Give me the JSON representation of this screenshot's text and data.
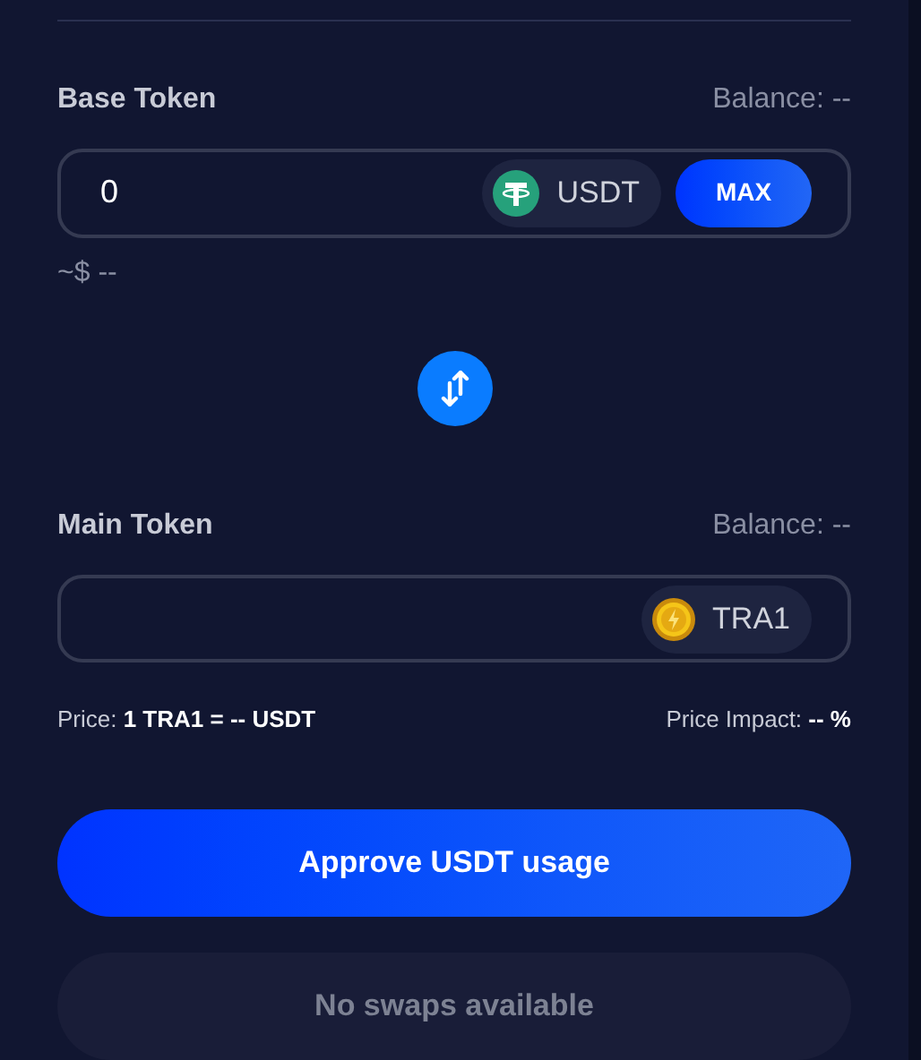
{
  "sections": [
    {
      "label": "Base Token",
      "balance": "Balance: --",
      "amount": "0",
      "token": "USDT",
      "max_button": "MAX",
      "usd_value": "~$ --"
    },
    {
      "label": "Main Token",
      "balance": "Balance: --",
      "token": "TRA1"
    }
  ],
  "price": "Price: **1 TRA1 = -- USDT**",
  "price_impact": "Price Impact: **-- %**",
  "buttons": [
    {
      "label": "Approve USDT usage",
      "disabled": false
    },
    {
      "label": "No swaps available",
      "disabled": true
    }
  ]
}
